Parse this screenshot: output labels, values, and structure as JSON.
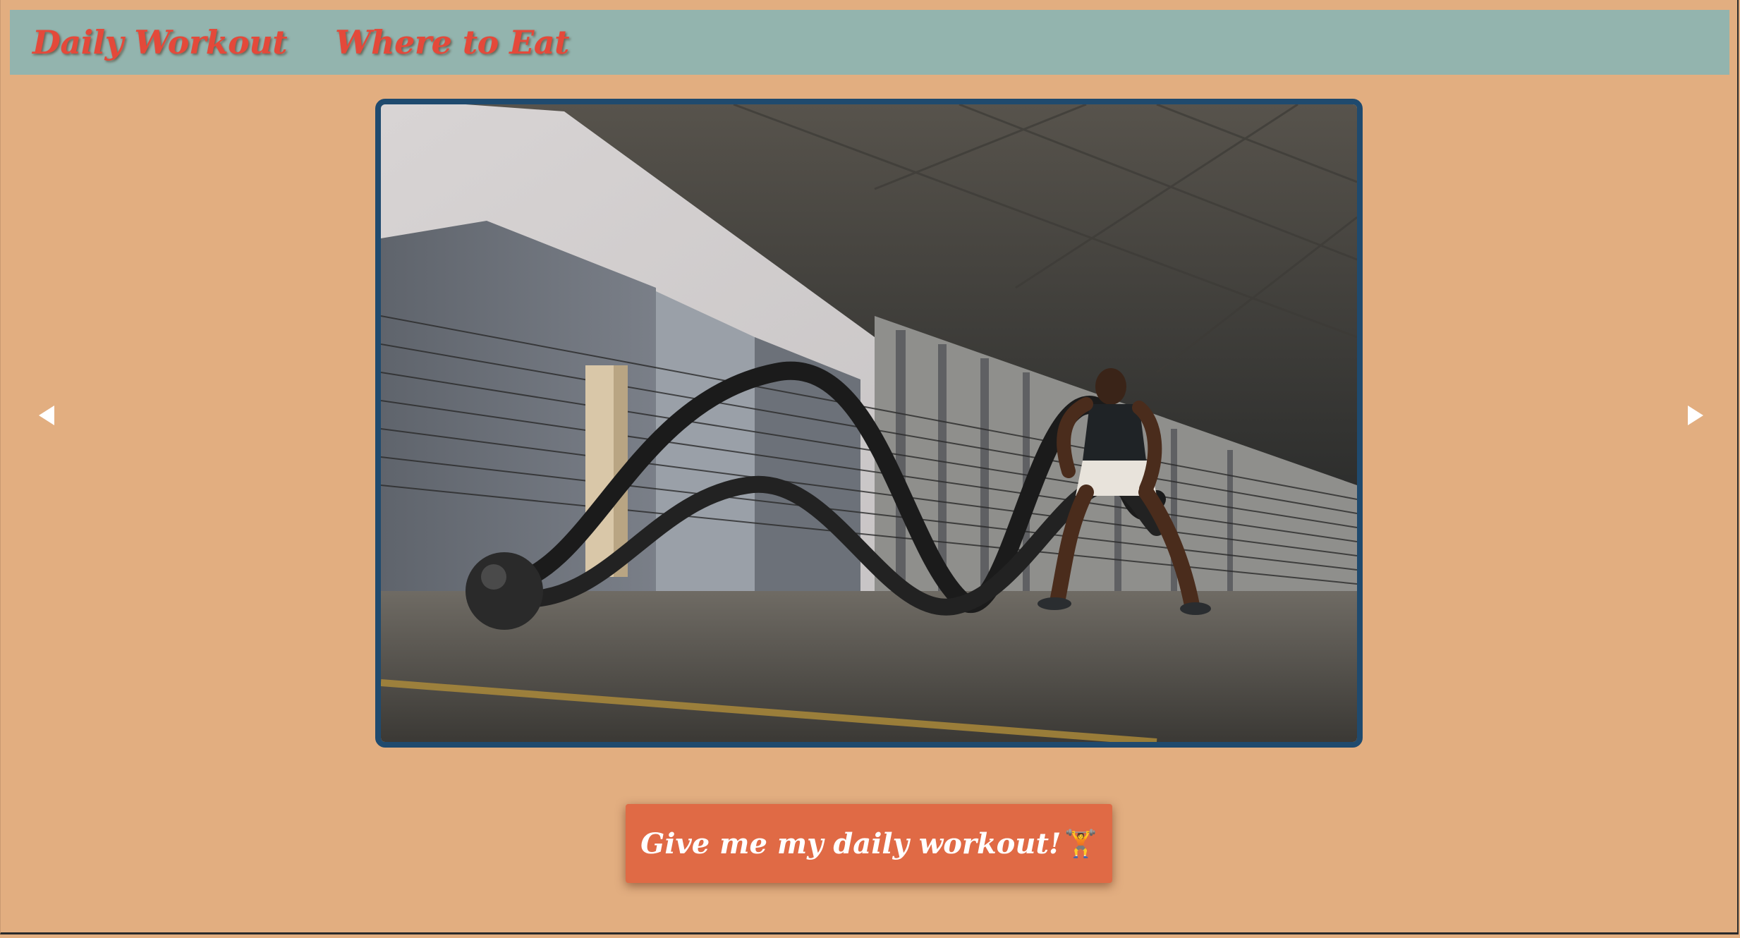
{
  "nav": {
    "items": [
      {
        "label": "Daily Workout"
      },
      {
        "label": "Where to Eat"
      }
    ]
  },
  "carousel": {
    "prev_icon": "caret-left-icon",
    "next_icon": "caret-right-icon",
    "image_desc": "workout photo"
  },
  "cta": {
    "label": "Give me my daily workout!",
    "icon_glyph": "🏋",
    "icon_name": "dumbbell-icon"
  },
  "colors": {
    "page_bg": "#e2ae80",
    "nav_bg": "#93b4ae",
    "nav_text": "#e4493a",
    "frame_border": "#1f4a6e",
    "button_bg": "#e06a45",
    "button_text": "#ffffff"
  }
}
